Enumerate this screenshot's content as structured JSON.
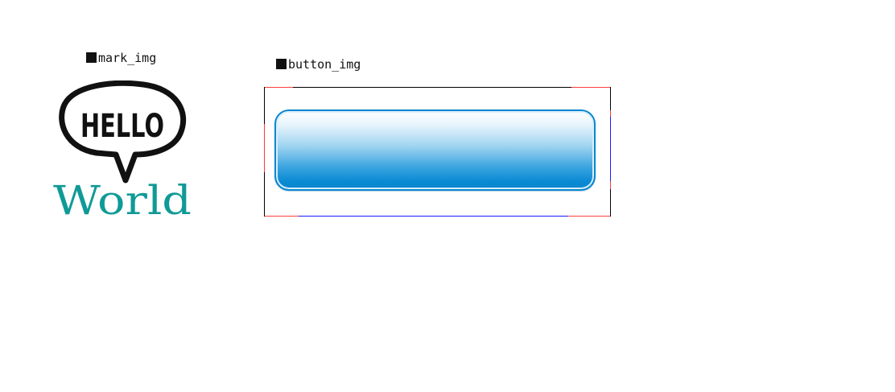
{
  "labels": {
    "mark": "mark_img",
    "button": "button_img"
  },
  "mark_image": {
    "line1": "HELLO",
    "line2": "World",
    "colors": {
      "bubble_stroke": "#111111",
      "world_text": "#0f9a97"
    }
  },
  "button_image": {
    "colors": {
      "border": "#0a86d0",
      "gradient_top": "#ffffff",
      "gradient_bottom": "#0a86d0",
      "guide_red": "#ff3b3b",
      "guide_blue": "#1a1aff"
    }
  }
}
